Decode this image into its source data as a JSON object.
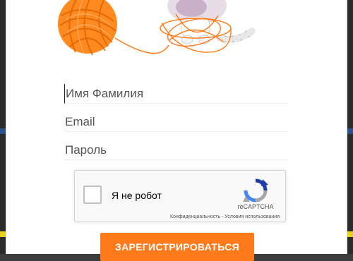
{
  "form": {
    "name_placeholder": "Имя Фамилия",
    "email_placeholder": "Email",
    "password_placeholder": "Пароль"
  },
  "captcha": {
    "label": "Я не робот",
    "brand": "reCAPTCHA",
    "privacy_link": "Конфиденциальность",
    "separator": " - ",
    "terms_link": "Условия использования"
  },
  "submit": {
    "label": "ЗАРЕГИСТРИРОВАТЬСЯ"
  },
  "colors": {
    "accent": "#ff7a1a",
    "captcha_blue": "#1c3aa9",
    "captcha_gray": "#a6a6a6"
  },
  "icons": {
    "illustration": "yarn-ball-and-cat-illustration",
    "captcha": "recaptcha-logo-icon"
  }
}
